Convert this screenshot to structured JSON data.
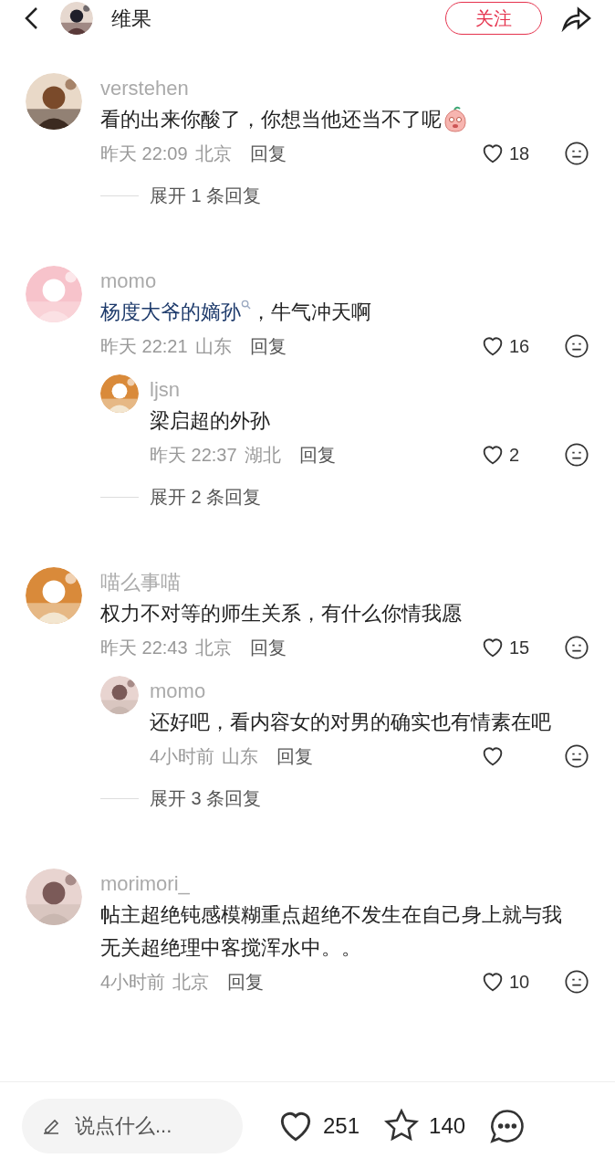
{
  "header": {
    "title": "维果",
    "follow": "关注"
  },
  "comments": [
    {
      "user": "verstehen",
      "segments": [
        {
          "kind": "plain",
          "text": "看的出来你酸了，你想当他还当不了呢"
        },
        {
          "kind": "sticker"
        }
      ],
      "time": "昨天 22:09",
      "location": "北京",
      "reply": "回复",
      "likes": "18",
      "expand": "展开 1 条回复"
    },
    {
      "user": "momo",
      "segments": [
        {
          "kind": "link",
          "text": "杨度大爷的嫡孙"
        },
        {
          "kind": "plain",
          "text": "，牛气冲天啊"
        }
      ],
      "time": "昨天 22:21",
      "location": "山东",
      "reply": "回复",
      "likes": "16",
      "replies": [
        {
          "user": "ljsn",
          "segments": [
            {
              "kind": "plain",
              "text": "梁启超的外孙"
            }
          ],
          "time": "昨天 22:37",
          "location": "湖北",
          "reply": "回复",
          "likes": "2"
        }
      ],
      "expand": "展开 2 条回复"
    },
    {
      "user": "喵么事喵",
      "segments": [
        {
          "kind": "plain",
          "text": "权力不对等的师生关系，有什么你情我愿"
        }
      ],
      "time": "昨天 22:43",
      "location": "北京",
      "reply": "回复",
      "likes": "15",
      "replies": [
        {
          "user": "momo",
          "segments": [
            {
              "kind": "plain",
              "text": "还好吧，看内容女的对男的确实也有情素在吧"
            }
          ],
          "time": "4小时前",
          "location": "山东",
          "reply": "回复"
        }
      ],
      "expand": "展开 3 条回复"
    },
    {
      "user": "morimori_",
      "segments": [
        {
          "kind": "plain",
          "text": "帖主超绝钝感模糊重点超绝不发生在自己身上就与我无关超绝理中客搅浑水中。。"
        }
      ],
      "time": "4小时前",
      "location": "北京",
      "reply": "回复",
      "likes": "10"
    }
  ],
  "bottom_bar": {
    "placeholder": "说点什么...",
    "likes": "251",
    "stars": "140"
  }
}
